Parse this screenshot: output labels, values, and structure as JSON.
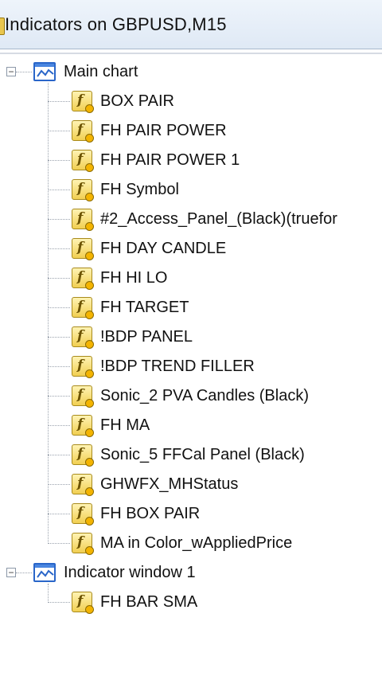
{
  "window": {
    "title": "Indicators on GBPUSD,M15"
  },
  "tree": {
    "groups": [
      {
        "label": "Main chart",
        "items": [
          {
            "label": "BOX PAIR"
          },
          {
            "label": "FH PAIR POWER"
          },
          {
            "label": "FH PAIR POWER 1"
          },
          {
            "label": "FH Symbol"
          },
          {
            "label": "#2_Access_Panel_(Black)(truefor"
          },
          {
            "label": "FH DAY CANDLE"
          },
          {
            "label": "FH HI LO"
          },
          {
            "label": "FH TARGET"
          },
          {
            "label": "!BDP PANEL"
          },
          {
            "label": "!BDP TREND FILLER"
          },
          {
            "label": "Sonic_2 PVA Candles (Black)"
          },
          {
            "label": "FH MA"
          },
          {
            "label": "Sonic_5 FFCal Panel (Black)"
          },
          {
            "label": "GHWFX_MHStatus"
          },
          {
            "label": "FH BOX PAIR"
          },
          {
            "label": "MA in Color_wAppliedPrice"
          }
        ]
      },
      {
        "label": "Indicator window 1",
        "items": [
          {
            "label": "FH BAR SMA"
          }
        ]
      }
    ]
  },
  "icons": {
    "group": "chart-window-icon",
    "item": "custom-indicator-icon",
    "expander": "collapse-icon"
  },
  "colors": {
    "title_bg": "#dfe9f5",
    "chart_icon_blue": "#2a66c9",
    "indicator_icon_yellow": "#f1cf52"
  }
}
